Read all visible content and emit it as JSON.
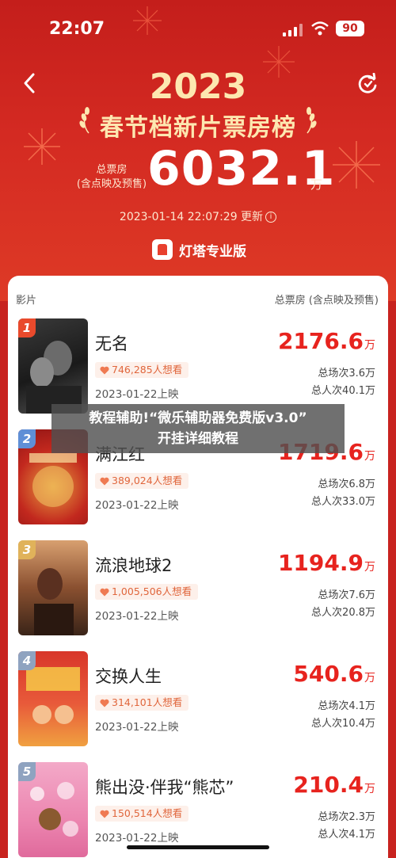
{
  "status_bar": {
    "time": "22:07",
    "battery": "90"
  },
  "header": {
    "year": "2023",
    "title": "春节档新片票房榜",
    "total_label_line1": "总票房",
    "total_label_line2": "(含点映及预售)",
    "total_value": "6032.1",
    "total_unit": "万",
    "update_time": "2023-01-14 22:07:29 更新",
    "brand_name": "灯塔专业版"
  },
  "table": {
    "col_film": "影片",
    "col_box": "总票房 (含点映及预售)"
  },
  "movies": [
    {
      "rank": "1",
      "name": "无名",
      "want": "746,285人想看",
      "release": "2023-01-22上映",
      "box": "2176.6",
      "unit": "万",
      "sessions": "总场次3.6万",
      "viewers": "总人次40.1万"
    },
    {
      "rank": "2",
      "name": "满江红",
      "want": "389,024人想看",
      "release": "2023-01-22上映",
      "box": "1719.6",
      "unit": "万",
      "sessions": "总场次6.8万",
      "viewers": "总人次33.0万"
    },
    {
      "rank": "3",
      "name": "流浪地球2",
      "want": "1,005,506人想看",
      "release": "2023-01-22上映",
      "box": "1194.9",
      "unit": "万",
      "sessions": "总场次7.6万",
      "viewers": "总人次20.8万"
    },
    {
      "rank": "4",
      "name": "交换人生",
      "want": "314,101人想看",
      "release": "2023-01-22上映",
      "box": "540.6",
      "unit": "万",
      "sessions": "总场次4.1万",
      "viewers": "总人次10.4万"
    },
    {
      "rank": "5",
      "name": "熊出没·伴我“熊芯”",
      "want": "150,514人想看",
      "release": "2023-01-22上映",
      "box": "210.4",
      "unit": "万",
      "sessions": "总场次2.3万",
      "viewers": "总人次4.1万"
    }
  ],
  "overlay": {
    "line1": "教程辅助!“微乐辅助器免费版v3.0”",
    "line2": "开挂详细教程"
  },
  "colors": {
    "accent": "#e7231e",
    "hero": "#c8231f",
    "gold": "#fde7b0"
  },
  "icons": [
    "back-icon",
    "refresh-icon",
    "info-icon",
    "heart-icon",
    "signal-icon",
    "wifi-icon",
    "battery-icon"
  ]
}
